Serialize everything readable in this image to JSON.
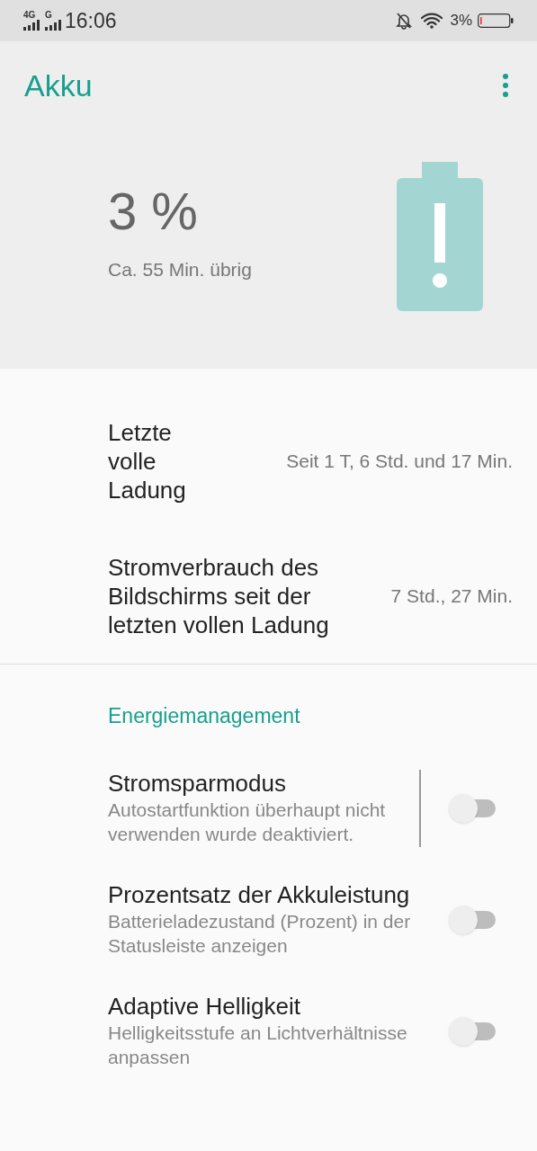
{
  "status_bar": {
    "network_1": "4G",
    "network_2": "G",
    "time": "16:06",
    "battery_percent": "3%"
  },
  "app_bar": {
    "title": "Akku"
  },
  "battery": {
    "percent": "3 %",
    "remaining": "Ca. 55 Min. übrig"
  },
  "info_rows": [
    {
      "label": "Letzte volle Ladung",
      "value": "Seit 1 T, 6 Std. und 17 Min."
    },
    {
      "label": "Stromverbrauch des Bildschirms seit der letzten vollen Ladung",
      "value": "7 Std., 27 Min."
    }
  ],
  "section": {
    "title": "Energiemanagement"
  },
  "settings": [
    {
      "title": "Stromsparmodus",
      "subtitle": "Autostartfunktion überhaupt nicht verwenden wurde deaktiviert.",
      "on": false,
      "separator": true
    },
    {
      "title": "Prozentsatz der Akkuleistung",
      "subtitle": "Batterieladezustand (Prozent) in der Statusleiste anzeigen",
      "on": false,
      "separator": false
    },
    {
      "title": "Adaptive Helligkeit",
      "subtitle": "Helligkeitsstufe an Lichtverhältnisse anpassen",
      "on": false,
      "separator": false
    }
  ]
}
